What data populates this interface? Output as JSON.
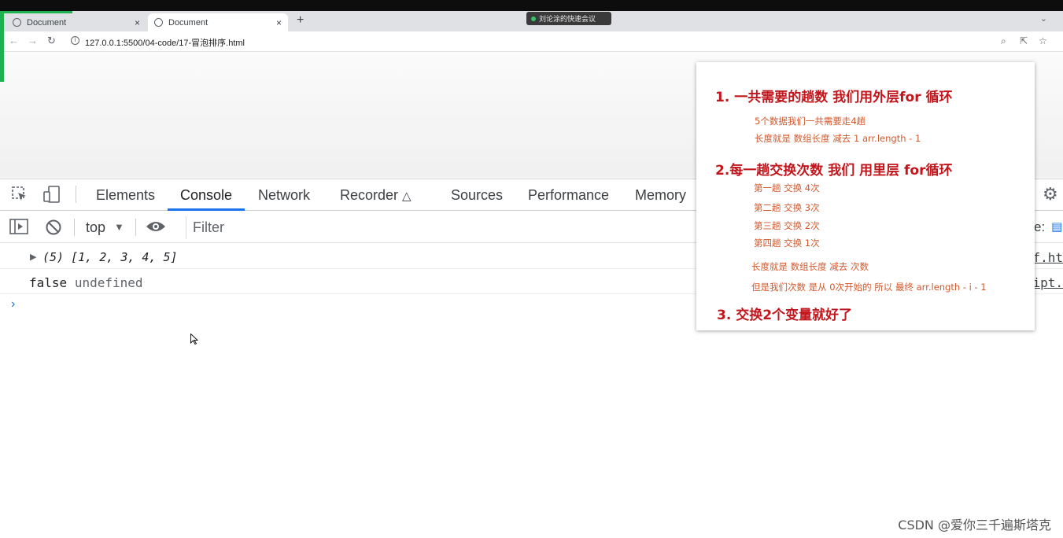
{
  "browser": {
    "tabs": [
      {
        "title": "Document",
        "active": false
      },
      {
        "title": "Document",
        "active": true
      }
    ],
    "tab_close_glyph": "×",
    "new_tab_glyph": "+",
    "meeting_banner": "刘论涂的快速会议",
    "url": "127.0.0.1:5500/04-code/17-冒泡排序.html"
  },
  "devtools": {
    "tabs": [
      "Elements",
      "Console",
      "Network",
      "Recorder",
      "Sources",
      "Performance",
      "Memory"
    ],
    "active_tab": "Console",
    "context": "top",
    "filter_placeholder": "Filter",
    "levels_label": "e:",
    "console": {
      "array_log": "(5) [1, 2, 3, 4, 5]",
      "false_text": "false",
      "undefined_text": "undefined",
      "source_link_1": "f.ht",
      "source_link_2": "ipt."
    }
  },
  "overlay": {
    "heading1": "1. 一共需要的趟数 我们用外层for 循环",
    "note1a": "5个数据我们一共需要走4趟",
    "note1b": "长度就是 数组长度 减去 1   arr.length - 1",
    "heading2": "2.每一趟交换次数 我们 用里层 for循环",
    "pass1": "第一趟 交换 4次",
    "pass2": "第二趟 交换 3次",
    "pass3": "第三趟 交换 2次",
    "pass4": "第四趟 交换 1次",
    "note2a": "长度就是 数组长度 减去  次数",
    "note2b": "但是我们次数 是从 0次开始的   所以  最终   arr.length - i - 1",
    "heading3": "3. 交换2个变量就好了"
  },
  "watermark": "CSDN @爱你三千遍斯塔克",
  "colors": {
    "accent": "#1a73e8",
    "overlay_heading": "#c0161c",
    "overlay_text": "#d2582c",
    "green_progress": "#1fb14f"
  }
}
